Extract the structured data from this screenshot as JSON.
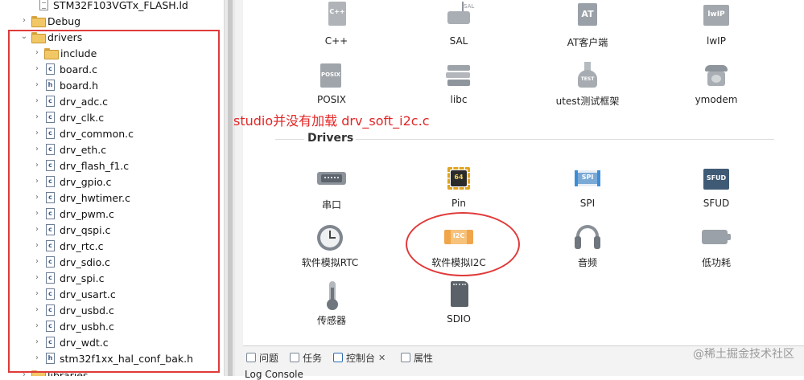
{
  "tree": {
    "rows": [
      {
        "label": "STM32F103VGTx_FLASH.ld",
        "kind": "file",
        "twisty": ""
      },
      {
        "label": "Debug",
        "kind": "folder",
        "twisty": "›"
      },
      {
        "label": "drivers",
        "kind": "folder",
        "twisty": "⌄"
      },
      {
        "label": "include",
        "kind": "folder",
        "twisty": "›"
      },
      {
        "label": "board.c",
        "kind": "c",
        "twisty": "›"
      },
      {
        "label": "board.h",
        "kind": "h",
        "twisty": "›"
      },
      {
        "label": "drv_adc.c",
        "kind": "c",
        "twisty": "›"
      },
      {
        "label": "drv_clk.c",
        "kind": "c",
        "twisty": "›"
      },
      {
        "label": "drv_common.c",
        "kind": "c",
        "twisty": "›"
      },
      {
        "label": "drv_eth.c",
        "kind": "c",
        "twisty": "›"
      },
      {
        "label": "drv_flash_f1.c",
        "kind": "c",
        "twisty": "›"
      },
      {
        "label": "drv_gpio.c",
        "kind": "c",
        "twisty": "›"
      },
      {
        "label": "drv_hwtimer.c",
        "kind": "c",
        "twisty": "›"
      },
      {
        "label": "drv_pwm.c",
        "kind": "c",
        "twisty": "›"
      },
      {
        "label": "drv_qspi.c",
        "kind": "c",
        "twisty": "›"
      },
      {
        "label": "drv_rtc.c",
        "kind": "c",
        "twisty": "›"
      },
      {
        "label": "drv_sdio.c",
        "kind": "c",
        "twisty": "›"
      },
      {
        "label": "drv_spi.c",
        "kind": "c",
        "twisty": "›"
      },
      {
        "label": "drv_usart.c",
        "kind": "c",
        "twisty": "›"
      },
      {
        "label": "drv_usbd.c",
        "kind": "c",
        "twisty": "›"
      },
      {
        "label": "drv_usbh.c",
        "kind": "c",
        "twisty": "›"
      },
      {
        "label": "drv_wdt.c",
        "kind": "c",
        "twisty": "›"
      },
      {
        "label": "stm32f1xx_hal_conf_bak.h",
        "kind": "h",
        "twisty": "›"
      },
      {
        "label": "libraries",
        "kind": "folder",
        "twisty": "›"
      }
    ]
  },
  "annotation": "studio并没有加载 drv_soft_i2c.c",
  "components": {
    "row1": [
      {
        "label": "C++",
        "icon": "cpp-icon"
      },
      {
        "label": "SAL",
        "icon": "sal-icon"
      },
      {
        "label": "AT客户端",
        "icon": "at-client-icon"
      },
      {
        "label": "lwIP",
        "icon": "lwip-icon"
      }
    ],
    "row2": [
      {
        "label": "POSIX",
        "icon": "posix-icon"
      },
      {
        "label": "libc",
        "icon": "libc-icon"
      },
      {
        "label": "utest测试框架",
        "icon": "utest-icon"
      },
      {
        "label": "ymodem",
        "icon": "ymodem-icon"
      }
    ],
    "drivers_title": "Drivers",
    "drivers_row1": [
      {
        "label": "串口",
        "icon": "serial-port-icon"
      },
      {
        "label": "Pin",
        "icon": "pin-chip-icon"
      },
      {
        "label": "SPI",
        "icon": "spi-icon"
      },
      {
        "label": "SFUD",
        "icon": "sfud-icon"
      }
    ],
    "drivers_row2": [
      {
        "label": "软件模拟RTC",
        "icon": "rtc-clock-icon"
      },
      {
        "label": "软件模拟I2C",
        "icon": "i2c-icon"
      },
      {
        "label": "音频",
        "icon": "headphones-icon"
      },
      {
        "label": "低功耗",
        "icon": "battery-icon"
      }
    ],
    "drivers_row3": [
      {
        "label": "传感器",
        "icon": "thermometer-icon"
      },
      {
        "label": "SDIO",
        "icon": "sd-card-icon"
      }
    ],
    "icon_text": {
      "cpp": "C++",
      "sal": "SAL",
      "at": "AT",
      "lwip": "lwIP",
      "posix": "POSIX",
      "test": "TEST",
      "pin": "64",
      "spi": "SPI",
      "sfud": "SFUD",
      "i2c": "I2C"
    }
  },
  "bottom_tabs": [
    {
      "label": "问题",
      "active": false
    },
    {
      "label": "任务",
      "active": false
    },
    {
      "label": "控制台",
      "active": true
    },
    {
      "label": "属性",
      "active": false
    }
  ],
  "log_console": "Log Console",
  "watermark": "@稀土掘金技术社区",
  "colors": {
    "highlight_red": "#e03a3a",
    "annotation_red": "#e22525"
  }
}
